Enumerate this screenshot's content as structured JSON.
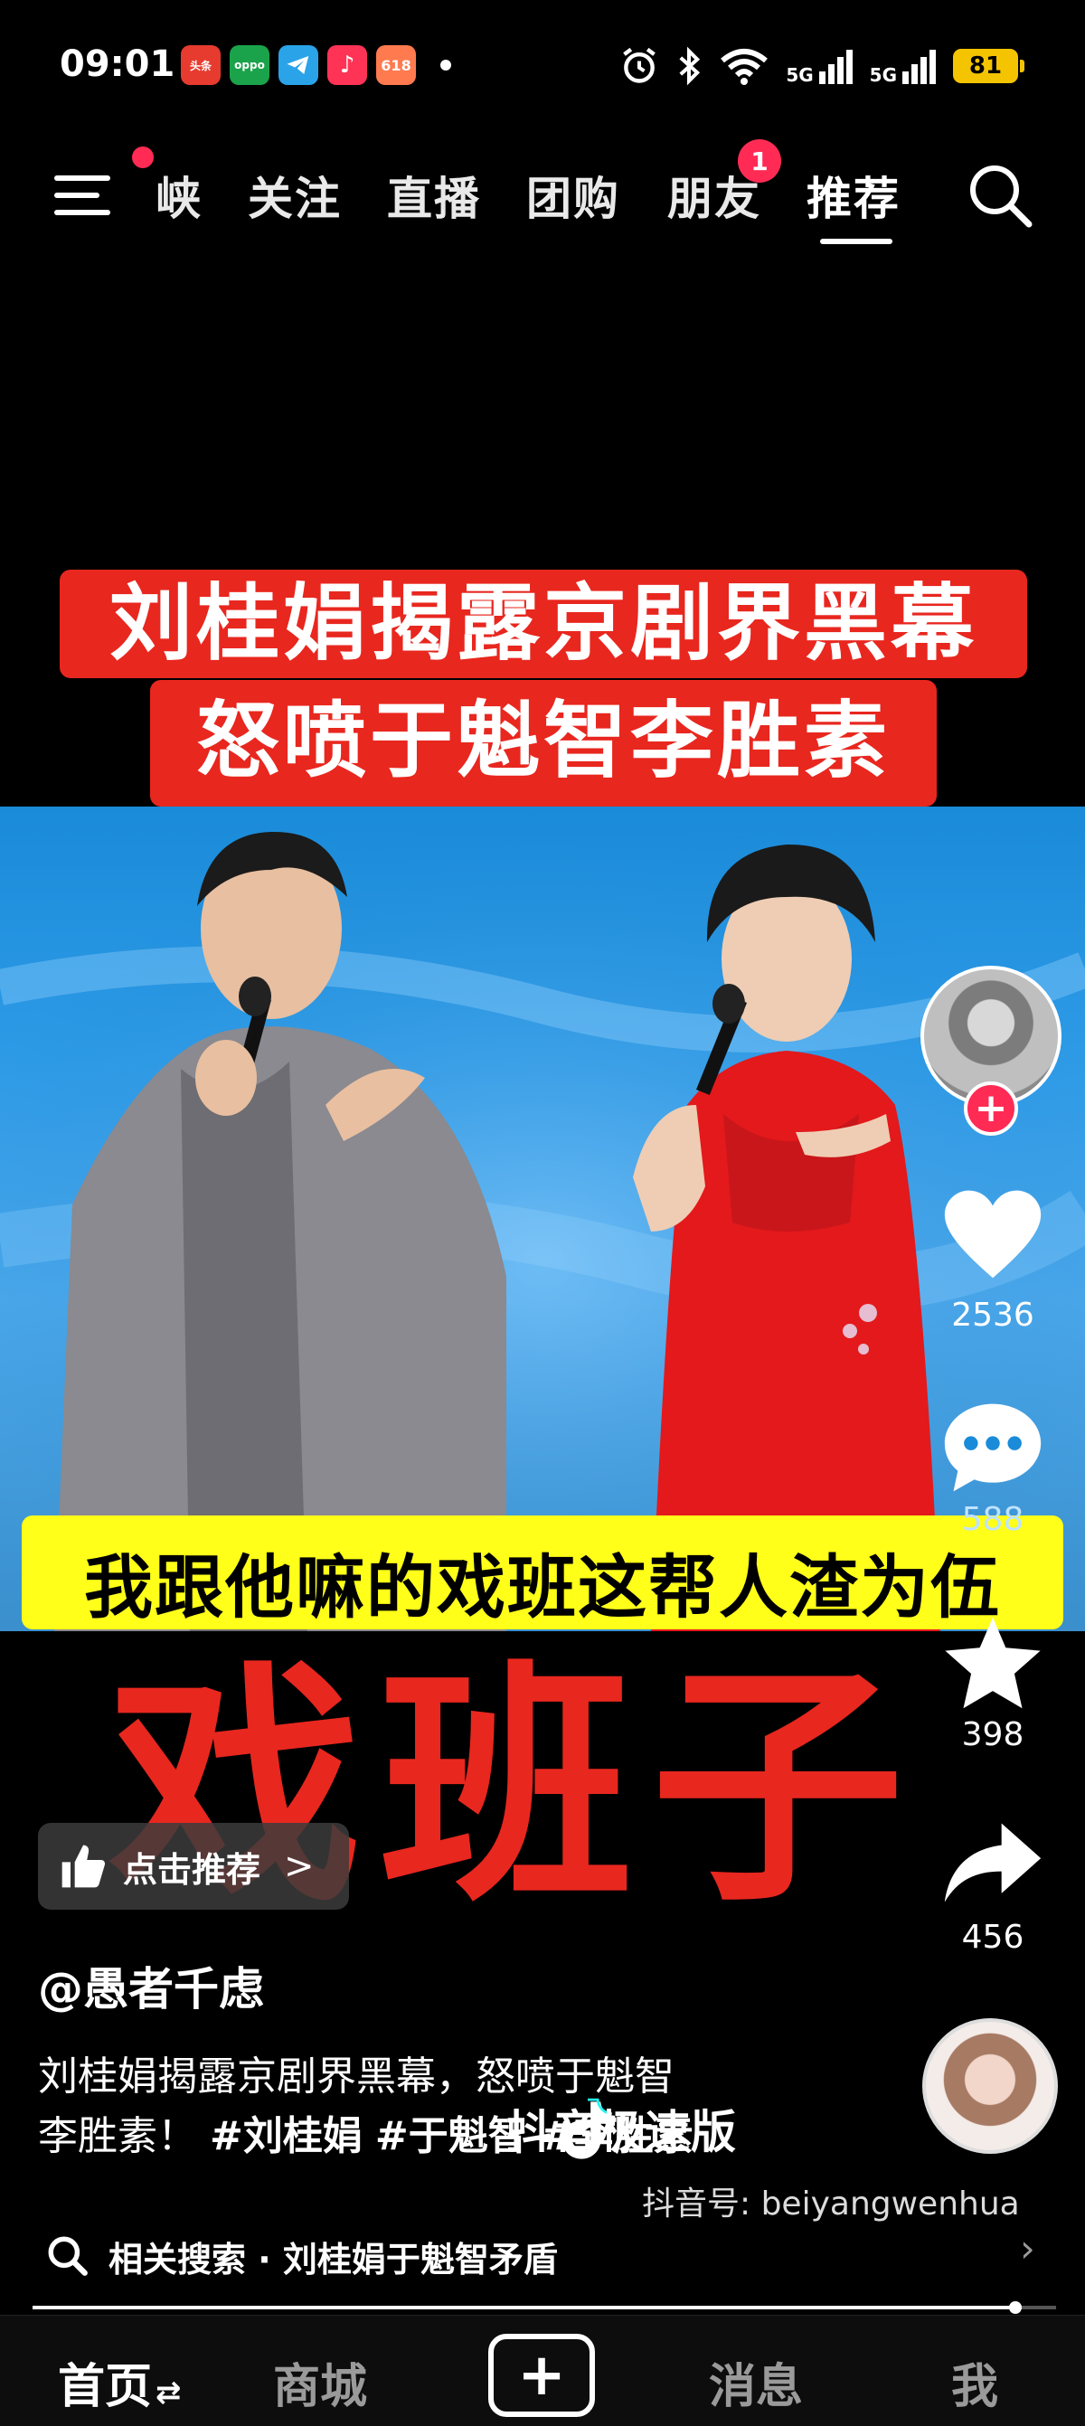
{
  "status_bar": {
    "time": "09:01",
    "apps": [
      {
        "name": "toutiao-app-icon",
        "label": "头条",
        "color": "#e63b2e"
      },
      {
        "name": "oppo-app-icon",
        "label": "oppo",
        "color": "#1aa34a"
      },
      {
        "name": "telegram-app-icon",
        "label": "",
        "color": "#2aa3e8"
      },
      {
        "name": "music-app-icon",
        "label": "♪",
        "color": "#ff3355"
      },
      {
        "name": "shop-618-app-icon",
        "label": "618",
        "color": "#ff7a4f"
      }
    ],
    "signal_1": "5G",
    "signal_2": "5G",
    "battery": "81"
  },
  "top_nav": {
    "tabs": [
      "峡",
      "关注",
      "直播",
      "团购",
      "朋友",
      "推荐"
    ],
    "active_tab": "推荐",
    "friends_badge": "1"
  },
  "video": {
    "headline_line_1": "刘桂娟揭露京剧界黑幕",
    "headline_line_2": "怒喷于魁智李胜素",
    "subtitle": "我跟他嘛的戏班这帮人渣为伍",
    "big_overlay": "戏班子"
  },
  "actions": {
    "follow_plus": "+",
    "likes": "2536",
    "comments": "588",
    "favorites": "398",
    "shares": "456"
  },
  "like_pill": {
    "label": "点击推荐",
    "chevron": ">"
  },
  "post": {
    "author": "@愚者千虑",
    "caption_line_1": "刘桂娟揭露京剧界黑幕，怒喷于魁智",
    "caption_line_2_prefix": "李胜素！",
    "hashtags": [
      "#刘桂娟",
      "#于魁智",
      "#李胜素"
    ]
  },
  "watermark": {
    "brand": "抖音极速版",
    "account": "抖音号: beiyangwenhua"
  },
  "related_search": {
    "text": "相关搜索 · 刘桂娟于魁智矛盾",
    "chevron": "›"
  },
  "progress": {
    "fraction": 0.96
  },
  "bottom_nav": {
    "home": "首页",
    "home_suffix": "⇄",
    "mall": "商城",
    "create": "+",
    "messages": "消息",
    "me": "我"
  },
  "colors": {
    "accent": "#ff2b55",
    "headline_bg": "#e8271f",
    "subtitle_bg": "#ffff1a",
    "battery": "#f5c400"
  }
}
